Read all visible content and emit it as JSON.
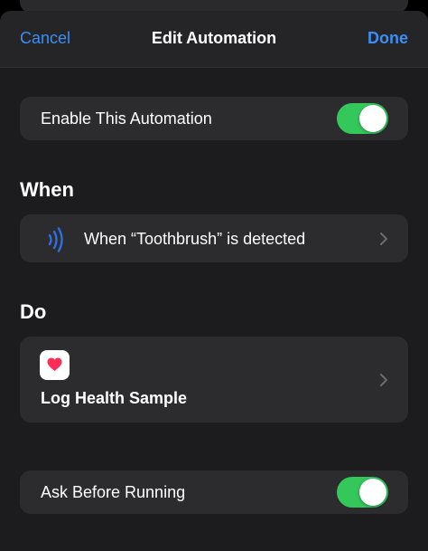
{
  "nav": {
    "cancel_label": "Cancel",
    "title": "Edit Automation",
    "done_label": "Done"
  },
  "enable_row": {
    "label": "Enable This Automation",
    "toggle_on": true
  },
  "when_section": {
    "header": "When",
    "trigger_label": "When “Toothbrush” is detected",
    "icon": "nfc-icon"
  },
  "do_section": {
    "header": "Do",
    "action_label": "Log Health Sample",
    "icon": "health-heart-icon"
  },
  "ask_row": {
    "label": "Ask Before Running",
    "toggle_on": true
  },
  "colors": {
    "accent_blue": "#3b8ef5",
    "toggle_green": "#34c759",
    "nfc_blue": "#2f6fe4",
    "heart_pink": "#ff2d55"
  }
}
